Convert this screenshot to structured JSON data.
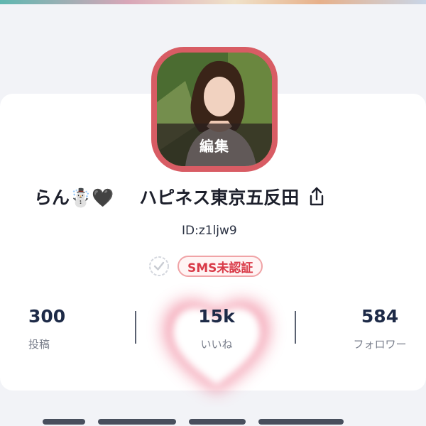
{
  "profile": {
    "edit_label": "編集",
    "nickname": "らん☃️🖤",
    "shop_name": "ハピネス東京五反田",
    "user_id": "ID:z1ljw9",
    "sms_badge": "SMS未認証"
  },
  "stats": {
    "posts_value": "300",
    "posts_label": "投稿",
    "likes_value": "15k",
    "likes_label": "いいね",
    "followers_value": "584",
    "followers_label": "フォロワー"
  },
  "icons": {
    "share": "share-icon",
    "verify": "check-circle-icon",
    "heart": "heart-glow-icon"
  },
  "colors": {
    "avatar_border": "#d85c64",
    "badge_text": "#d93a48",
    "badge_border": "#f0a3a6",
    "stat_number": "#1d2a47"
  }
}
